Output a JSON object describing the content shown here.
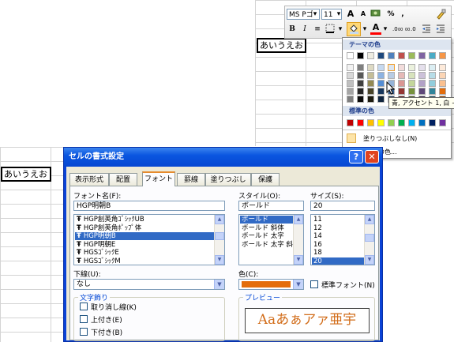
{
  "sheet_top": {
    "cell_text": "あいうえお"
  },
  "sheet_left": {
    "cell_text": "あいうえお"
  },
  "toolbar": {
    "font_name": "MS Pゴ",
    "font_size": "11",
    "grow_font": "A",
    "shrink_font": "A",
    "percent": "%",
    "comma": ",",
    "bold": "B",
    "italic": "I",
    "align": "≡",
    "font_color_letter": "A"
  },
  "palette": {
    "theme_header": "テーマの色",
    "standard_header": "標準の色",
    "no_fill": "塗りつぶしなし(N)",
    "more_colors": "の色...",
    "theme_top_row": [
      "#ffffff",
      "#000000",
      "#eeece1",
      "#1f497d",
      "#4f81bd",
      "#c0504d",
      "#9bbb59",
      "#8064a2",
      "#4bacc6",
      "#f79646"
    ],
    "theme_shades": [
      [
        "#f2f2f2",
        "#7f7f7f",
        "#ddd9c3",
        "#c6d9f0",
        "#dbe5f1",
        "#f2dcdb",
        "#ebf1dd",
        "#e5e0ec",
        "#dbeef3",
        "#fdeada"
      ],
      [
        "#d8d8d8",
        "#595959",
        "#c4bd97",
        "#8db3e2",
        "#b8cce4",
        "#e5b9b7",
        "#d7e3bc",
        "#ccc1d9",
        "#b7dde8",
        "#fbd5b5"
      ],
      [
        "#bfbfbf",
        "#3f3f3f",
        "#938953",
        "#548dd4",
        "#95b3d7",
        "#d99694",
        "#c3d69b",
        "#b2a2c7",
        "#92cddc",
        "#fac08f"
      ],
      [
        "#a5a5a5",
        "#262626",
        "#494429",
        "#17365d",
        "#366092",
        "#953734",
        "#76923c",
        "#5f497a",
        "#31859b",
        "#e36c09"
      ],
      [
        "#7f7f7f",
        "#0c0c0c",
        "#1d1b10",
        "#0f243e",
        "#244061",
        "#632423",
        "#4f6128",
        "#3f3151",
        "#205867",
        "#974806"
      ]
    ],
    "standard": [
      "#c00000",
      "#ff0000",
      "#ffc000",
      "#ffff00",
      "#92d050",
      "#00b050",
      "#00b0f0",
      "#0070c0",
      "#002060",
      "#7030a0"
    ]
  },
  "tooltip": {
    "text": "青, アクセント 1, 白 +"
  },
  "dialog": {
    "title": "セルの書式設定",
    "help_button": "?",
    "close_button": "✕",
    "tabs": [
      "表示形式",
      "配置",
      "フォント",
      "罫線",
      "塗りつぶし",
      "保護"
    ],
    "font_name_label": "フォント名(F):",
    "font_name_value": "HGP明朝B",
    "font_list": [
      "HGP創英角ｺﾞｼｯｸUB",
      "HGP創英角ﾎﾟｯﾌﾟ体",
      "HGP明朝B",
      "HGP明朝E",
      "HGSｺﾞｼｯｸE",
      "HGSｺﾞｼｯｸM"
    ],
    "font_icon": "Ŧ",
    "style_label": "スタイル(O):",
    "style_value": "ボールド",
    "style_list": [
      "ボールド",
      "ボールド 斜体",
      "ボールド 太字",
      "ボールド 太字 斜体"
    ],
    "size_label": "サイズ(S):",
    "size_value": "20",
    "size_list": [
      "11",
      "12",
      "14",
      "16",
      "18",
      "20"
    ],
    "underline_label": "下線(U):",
    "underline_value": "なし",
    "color_label": "色(C):",
    "color_value": "#e46c0a",
    "normal_font_label": "標準フォント(N)",
    "effects_title": "文字飾り",
    "strike_label": "取り消し線(K)",
    "super_label": "上付き(E)",
    "sub_label": "下付き(B)",
    "preview_title": "プレビュー",
    "preview_text": "Aaあぁアァ亜宇"
  }
}
